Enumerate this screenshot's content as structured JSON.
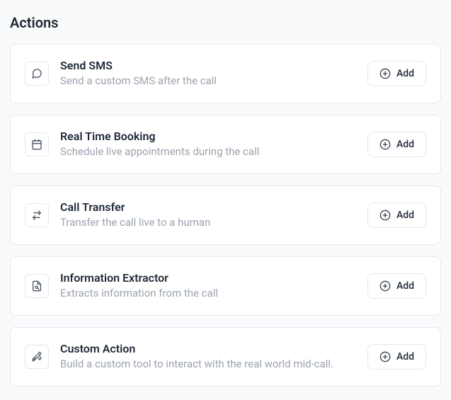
{
  "section_title": "Actions",
  "add_label": "Add",
  "actions": [
    {
      "icon": "message-circle",
      "title": "Send SMS",
      "description": "Send a custom SMS after the call"
    },
    {
      "icon": "calendar",
      "title": "Real Time Booking",
      "description": "Schedule live appointments during the call"
    },
    {
      "icon": "swap",
      "title": "Call Transfer",
      "description": "Transfer the call live to a human"
    },
    {
      "icon": "file-search",
      "title": "Information Extractor",
      "description": "Extracts information from the call"
    },
    {
      "icon": "tools",
      "title": "Custom Action",
      "description": "Build a custom tool to interact with the real world mid-call."
    }
  ]
}
